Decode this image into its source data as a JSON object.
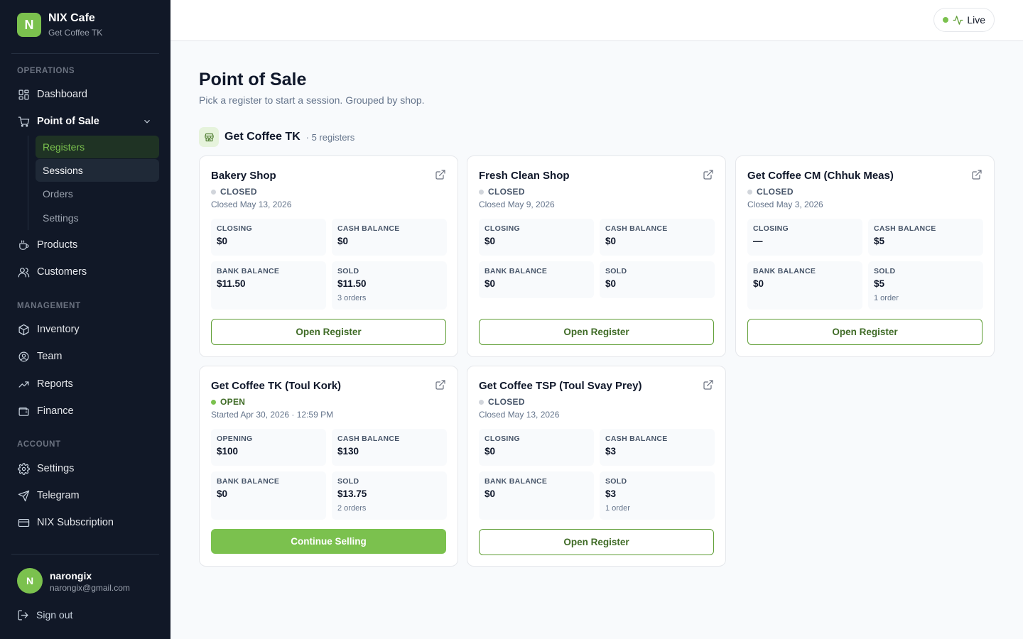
{
  "brand": {
    "logo_letter": "N",
    "name": "NIX Cafe",
    "subtitle": "Get Coffee TK"
  },
  "sidebar": {
    "operations_label": "OPERATIONS",
    "dashboard": "Dashboard",
    "pos": "Point of Sale",
    "pos_sub": {
      "registers": "Registers",
      "sessions": "Sessions",
      "orders": "Orders",
      "settings": "Settings"
    },
    "products": "Products",
    "customers": "Customers",
    "management_label": "MANAGEMENT",
    "inventory": "Inventory",
    "team": "Team",
    "reports": "Reports",
    "finance": "Finance",
    "account_label": "ACCOUNT",
    "settings": "Settings",
    "telegram": "Telegram",
    "subscription": "NIX Subscription"
  },
  "user": {
    "avatar_letter": "N",
    "name": "narongix",
    "email": "narongix@gmail.com",
    "signout": "Sign out"
  },
  "topbar": {
    "live_label": "Live"
  },
  "page": {
    "title": "Point of Sale",
    "subtitle": "Pick a register to start a session. Grouped by shop."
  },
  "shop": {
    "name": "Get Coffee TK",
    "count": "· 5 registers"
  },
  "registers": [
    {
      "name": "Bakery Shop",
      "status": "CLOSED",
      "date": "Closed May 13, 2026",
      "s1_label": "CLOSING",
      "s1_value": "$0",
      "s2_label": "CASH BALANCE",
      "s2_value": "$0",
      "s3_label": "BANK BALANCE",
      "s3_value": "$11.50",
      "s4_label": "SOLD",
      "s4_value": "$11.50",
      "s4_sub": "3 orders",
      "button": "Open Register"
    },
    {
      "name": "Fresh Clean Shop",
      "status": "CLOSED",
      "date": "Closed May 9, 2026",
      "s1_label": "CLOSING",
      "s1_value": "$0",
      "s2_label": "CASH BALANCE",
      "s2_value": "$0",
      "s3_label": "BANK BALANCE",
      "s3_value": "$0",
      "s4_label": "SOLD",
      "s4_value": "$0",
      "s4_sub": "",
      "button": "Open Register"
    },
    {
      "name": "Get Coffee CM (Chhuk Meas)",
      "status": "CLOSED",
      "date": "Closed May 3, 2026",
      "s1_label": "CLOSING",
      "s1_value": "—",
      "s2_label": "CASH BALANCE",
      "s2_value": "$5",
      "s3_label": "BANK BALANCE",
      "s3_value": "$0",
      "s4_label": "SOLD",
      "s4_value": "$5",
      "s4_sub": "1 order",
      "button": "Open Register"
    },
    {
      "name": "Get Coffee TK (Toul Kork)",
      "status": "OPEN",
      "date": "Started Apr 30, 2026 · 12:59 PM",
      "s1_label": "OPENING",
      "s1_value": "$100",
      "s2_label": "CASH BALANCE",
      "s2_value": "$130",
      "s3_label": "BANK BALANCE",
      "s3_value": "$0",
      "s4_label": "SOLD",
      "s4_value": "$13.75",
      "s4_sub": "2 orders",
      "button": "Continue Selling"
    },
    {
      "name": "Get Coffee TSP (Toul Svay Prey)",
      "status": "CLOSED",
      "date": "Closed May 13, 2026",
      "s1_label": "CLOSING",
      "s1_value": "$0",
      "s2_label": "CASH BALANCE",
      "s2_value": "$3",
      "s3_label": "BANK BALANCE",
      "s3_value": "$0",
      "s4_label": "SOLD",
      "s4_value": "$3",
      "s4_sub": "1 order",
      "button": "Open Register"
    }
  ]
}
